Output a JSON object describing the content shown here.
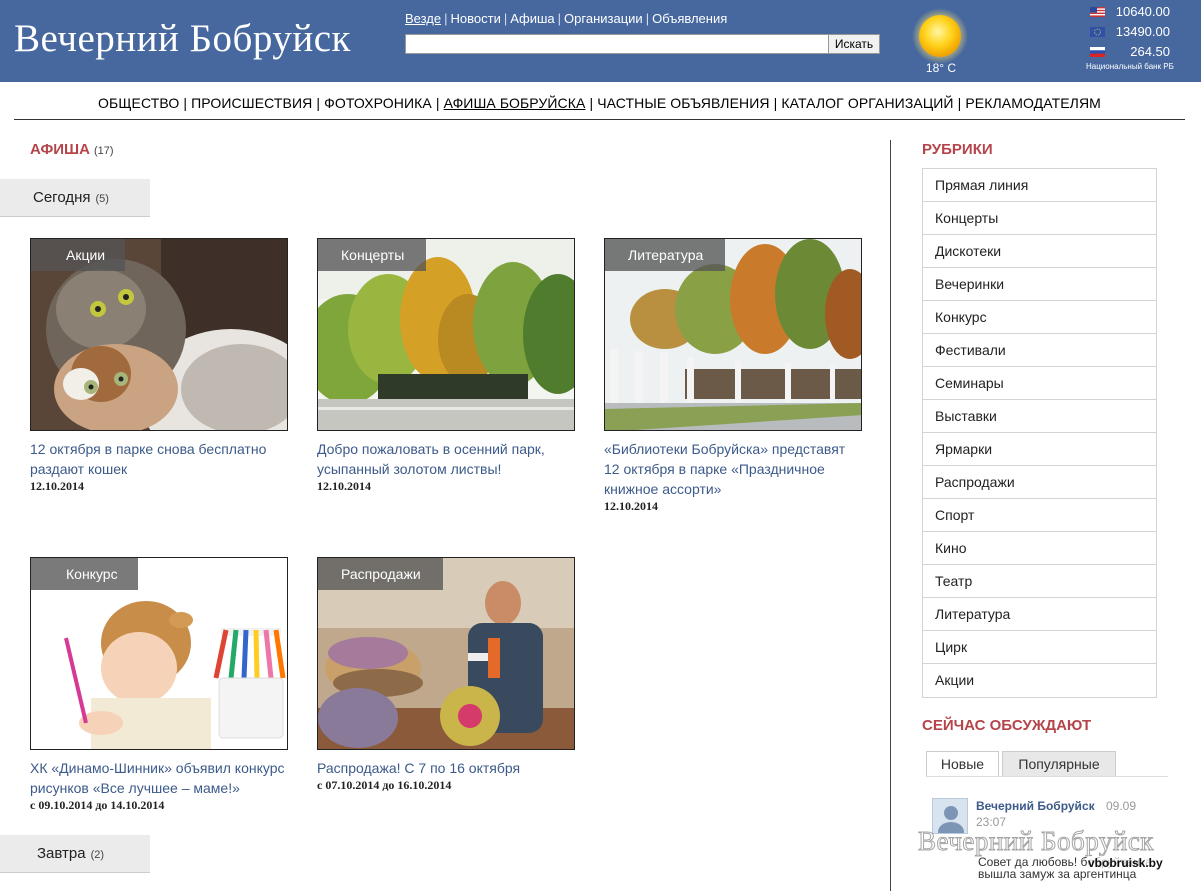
{
  "header": {
    "logo": "Вечерний Бобруйск",
    "nav": [
      {
        "label": "Везде",
        "active": true
      },
      {
        "label": "Новости"
      },
      {
        "label": "Афиша"
      },
      {
        "label": "Организации"
      },
      {
        "label": "Объявления"
      }
    ],
    "search": {
      "value": "",
      "button": "Искать"
    },
    "weather": {
      "temp": "18° C",
      "icon": "sun-icon"
    },
    "rates": [
      {
        "flag": "us-flag-icon",
        "value": "10640.00"
      },
      {
        "flag": "eu-flag-icon",
        "value": "13490.00"
      },
      {
        "flag": "ru-flag-icon",
        "value": "264.50"
      }
    ],
    "rates_note": "Национальный банк РБ"
  },
  "main_nav": [
    {
      "label": "ОБЩЕСТВО"
    },
    {
      "label": "ПРОИСШЕСТВИЯ"
    },
    {
      "label": "ФОТОХРОНИКА"
    },
    {
      "label": "АФИША БОБРУЙСКА",
      "active": true
    },
    {
      "label": "ЧАСТНЫЕ ОБЪЯВЛЕНИЯ"
    },
    {
      "label": "КАТАЛОГ ОРГАНИЗАЦИЙ"
    },
    {
      "label": "РЕКЛАМОДАТЕЛЯМ"
    }
  ],
  "afisha": {
    "title": "АФИША",
    "count": "(17)",
    "today": {
      "label": "Сегодня",
      "count": "(5)"
    },
    "tomorrow": {
      "label": "Завтра",
      "count": "(2)"
    },
    "cards": [
      {
        "category": "Акции",
        "title": "12 октября в парке снова бесплатно раздают кошек",
        "date": "12.10.2014",
        "image": "kittens"
      },
      {
        "category": "Концерты",
        "title": "Добро пожаловать в осенний парк, усыпанный золотом листвы!",
        "date": "12.10.2014",
        "image": "autumn-park"
      },
      {
        "category": "Литература",
        "title": "«Библиотеки Бобруйска» представят 12 октября в парке «Праздничное книжное ассорти»",
        "date": "12.10.2014",
        "image": "park-fence"
      },
      {
        "category": "Конкурс",
        "title": "ХК «Динамо-Шинник» объявил конкурс рисунков «Все лучшее – маме!»",
        "date": "с 09.10.2014 до 14.10.2014",
        "image": "child-drawing"
      },
      {
        "category": "Распродажи",
        "title": "Распродажа! С 7 по 16 октября",
        "date": "с 07.10.2014 до 16.10.2014",
        "image": "man-pillows"
      }
    ]
  },
  "sidebar": {
    "rubrics_title": "РУБРИКИ",
    "rubrics": [
      "Прямая линия",
      "Концерты",
      "Дискотеки",
      "Вечеринки",
      "Конкурс",
      "Фестивали",
      "Семинары",
      "Выставки",
      "Ярмарки",
      "Распродажи",
      "Спорт",
      "Кино",
      "Театр",
      "Литература",
      "Цирк",
      "Акции"
    ],
    "discuss_title": "СЕЙЧАС ОБСУЖДАЮТ",
    "tabs": [
      "Новые",
      "Популярные"
    ],
    "comment": {
      "author": "Вечерний Бобруйск",
      "date": "09.09",
      "time": "23:07",
      "text": "Совет да любовь! бобруйчанка вышла замуж за аргентинца"
    }
  },
  "watermark": {
    "title": "Вечерний Бобруйск",
    "url": "vbobruisk.by"
  }
}
